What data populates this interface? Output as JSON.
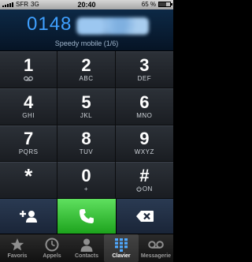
{
  "status_bar": {
    "carrier": "SFR",
    "network": "3G",
    "time": "20:40",
    "battery": "65 %",
    "battery_level": 0.65
  },
  "display": {
    "number_prefix": "0148",
    "contact_label": "Speedy mobile (1/6)"
  },
  "keypad": {
    "keys": [
      {
        "digit": "1",
        "letters": ""
      },
      {
        "digit": "2",
        "letters": "ABC"
      },
      {
        "digit": "3",
        "letters": "DEF"
      },
      {
        "digit": "4",
        "letters": "GHI"
      },
      {
        "digit": "5",
        "letters": "JKL"
      },
      {
        "digit": "6",
        "letters": "MNO"
      },
      {
        "digit": "7",
        "letters": "PQRS"
      },
      {
        "digit": "8",
        "letters": "TUV"
      },
      {
        "digit": "9",
        "letters": "WXYZ"
      },
      {
        "digit": "*",
        "letters": ""
      },
      {
        "digit": "0",
        "letters": "+"
      },
      {
        "digit": "#",
        "letters": "ON"
      }
    ]
  },
  "actions": {
    "add_icon": "add-contact-icon",
    "call_icon": "phone-icon",
    "delete_icon": "backspace-icon"
  },
  "tabbar": {
    "items": [
      {
        "label": "Favoris",
        "icon": "star-icon"
      },
      {
        "label": "Appels",
        "icon": "clock-icon"
      },
      {
        "label": "Contacts",
        "icon": "person-icon"
      },
      {
        "label": "Clavier",
        "icon": "keypad-icon",
        "active": true
      },
      {
        "label": "Messagerie",
        "icon": "voicemail-icon"
      }
    ]
  },
  "colors": {
    "number": "#3fa0ff",
    "call_button": "#2fbf2f",
    "display_bg": "#0d2946"
  }
}
